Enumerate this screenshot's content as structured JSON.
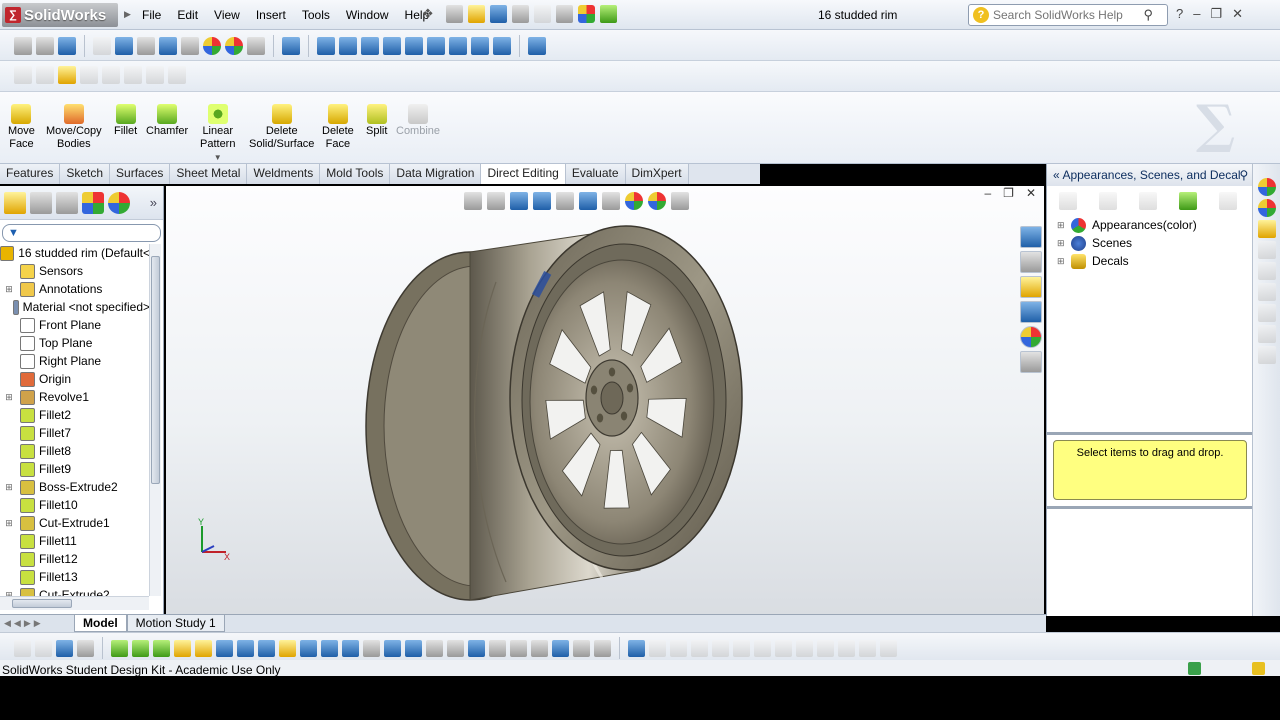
{
  "app": {
    "logo_text": "SolidWorks",
    "document_title": "16 studded rim",
    "search_placeholder": "Search SolidWorks Help"
  },
  "menu": [
    "File",
    "Edit",
    "View",
    "Insert",
    "Tools",
    "Window",
    "Help"
  ],
  "command_manager": {
    "commands": [
      {
        "label_1": "Move",
        "label_2": "Face",
        "icon": "move-face-icon"
      },
      {
        "label_1": "Move/Copy",
        "label_2": "Bodies",
        "icon": "move-copy-bodies-icon"
      },
      {
        "label_1": "Fillet",
        "label_2": "",
        "icon": "fillet-icon"
      },
      {
        "label_1": "Chamfer",
        "label_2": "",
        "icon": "chamfer-icon"
      },
      {
        "label_1": "Linear",
        "label_2": "Pattern",
        "icon": "linear-pattern-icon"
      },
      {
        "label_1": "Delete",
        "label_2": "Solid/Surface",
        "icon": "delete-solid-surface-icon"
      },
      {
        "label_1": "Delete",
        "label_2": "Face",
        "icon": "delete-face-icon"
      },
      {
        "label_1": "Split",
        "label_2": "",
        "icon": "split-icon"
      },
      {
        "label_1": "Combine",
        "label_2": "",
        "icon": "combine-icon",
        "disabled": true
      }
    ]
  },
  "tabs": [
    "Features",
    "Sketch",
    "Surfaces",
    "Sheet Metal",
    "Weldments",
    "Mold Tools",
    "Data Migration",
    "Direct Editing",
    "Evaluate",
    "DimXpert"
  ],
  "active_tab": "Direct Editing",
  "feature_tree": [
    {
      "label": "16 studded rim  (Default<",
      "icon_color": "#e8b400",
      "expandable": false,
      "root": true
    },
    {
      "label": "Sensors",
      "icon_color": "#f5d34a",
      "expandable": false
    },
    {
      "label": "Annotations",
      "icon_color": "#f0c84a",
      "expandable": true
    },
    {
      "label": "Material <not specified>",
      "icon_color": "#7a8fb0",
      "expandable": false
    },
    {
      "label": "Front Plane",
      "icon_color": "#ffffff",
      "expandable": false
    },
    {
      "label": "Top Plane",
      "icon_color": "#ffffff",
      "expandable": false
    },
    {
      "label": "Right Plane",
      "icon_color": "#ffffff",
      "expandable": false
    },
    {
      "label": "Origin",
      "icon_color": "#e06a3a",
      "expandable": false
    },
    {
      "label": "Revolve1",
      "icon_color": "#d0a24a",
      "expandable": true
    },
    {
      "label": "Fillet2",
      "icon_color": "#c8e040",
      "expandable": false
    },
    {
      "label": "Fillet7",
      "icon_color": "#c8e040",
      "expandable": false
    },
    {
      "label": "Fillet8",
      "icon_color": "#c8e040",
      "expandable": false
    },
    {
      "label": "Fillet9",
      "icon_color": "#c8e040",
      "expandable": false
    },
    {
      "label": "Boss-Extrude2",
      "icon_color": "#d8c040",
      "expandable": true
    },
    {
      "label": "Fillet10",
      "icon_color": "#c8e040",
      "expandable": false
    },
    {
      "label": "Cut-Extrude1",
      "icon_color": "#d8c040",
      "expandable": true
    },
    {
      "label": "Fillet11",
      "icon_color": "#c8e040",
      "expandable": false
    },
    {
      "label": "Fillet12",
      "icon_color": "#c8e040",
      "expandable": false
    },
    {
      "label": "Fillet13",
      "icon_color": "#c8e040",
      "expandable": false
    },
    {
      "label": "Cut-Extrude2",
      "icon_color": "#d8c040",
      "expandable": true
    }
  ],
  "task_pane": {
    "title": "Appearances, Scenes, and Decals",
    "items": [
      {
        "label": "Appearances(color)",
        "icon": "appearances-icon"
      },
      {
        "label": "Scenes",
        "icon": "scenes-icon"
      },
      {
        "label": "Decals",
        "icon": "decals-icon"
      }
    ],
    "drop_hint": "Select items to drag and drop."
  },
  "model_tabs": [
    "Model",
    "Motion Study 1"
  ],
  "status_text": "SolidWorks Student Design Kit - Academic Use Only",
  "triad": {
    "y_label": "Y",
    "x_label": "X"
  }
}
